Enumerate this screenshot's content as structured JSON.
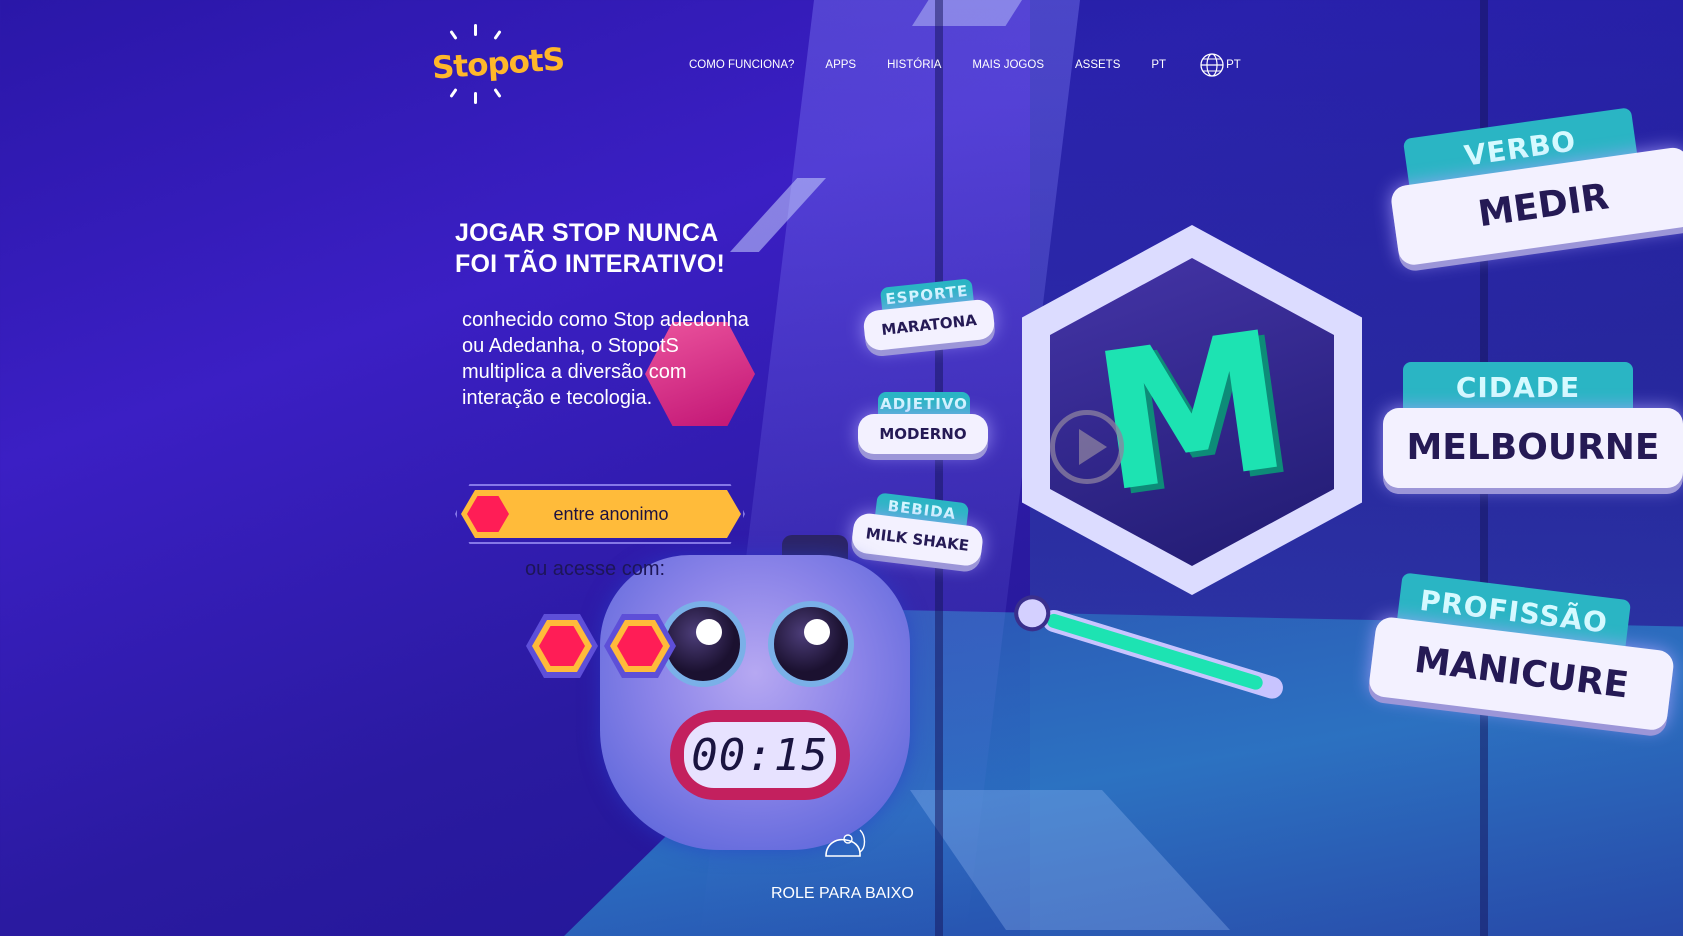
{
  "brand": {
    "logo_text": "StopotS",
    "accent": "#ffb72a"
  },
  "nav": {
    "items": [
      "COMO FUNCIONA?",
      "APPS",
      "HISTÓRIA",
      "MAIS JOGOS",
      "ASSETS",
      "PT"
    ],
    "language_label": "PT",
    "language_icon": "globe-icon"
  },
  "hero": {
    "headline_line1": "JOGAR STOP NUNCA",
    "headline_line2": "FOI TÃO INTERATIVO!",
    "intro": "conhecido como Stop adedonha ou Adedanha, o StopotS multiplica a diversão com interação e tecologia.",
    "cta_label": "entre anonimo",
    "or_label": "ou acesse com:",
    "social_buttons": [
      "social-login-1",
      "social-login-2"
    ]
  },
  "game_preview": {
    "letter": "M",
    "timer": "00:15",
    "timer_progress": 0.93,
    "categories_small": [
      {
        "category": "ESPORTE",
        "answer": "MARATONA"
      },
      {
        "category": "ADJETIVO",
        "answer": "MODERNO"
      },
      {
        "category": "BEBIDA",
        "answer": "MILK SHAKE"
      }
    ],
    "categories_big": [
      {
        "category": "VERBO",
        "answer": "MEDIR"
      },
      {
        "category": "CIDADE",
        "answer": "MELBOURNE"
      },
      {
        "category": "PROFISSÃO",
        "answer": "MANICURE"
      }
    ]
  },
  "scroll_hint": {
    "label": "ROLE PARA BAIXO",
    "icon": "mouse-icon"
  },
  "colors": {
    "cta": "#ffbb3a",
    "hex_red": "#ff1d56",
    "teal": "#1de3b2"
  }
}
